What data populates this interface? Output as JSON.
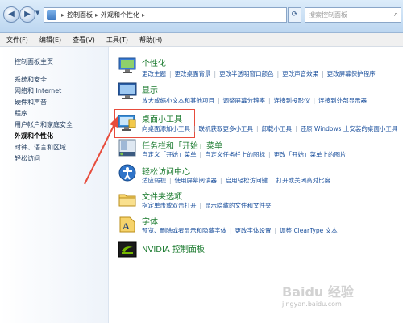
{
  "address": {
    "crumbs": [
      "控制面板",
      "外观和个性化"
    ],
    "search_placeholder": "搜索控制面板"
  },
  "menubar": {
    "items": [
      "文件(F)",
      "编辑(E)",
      "查看(V)",
      "工具(T)",
      "帮助(H)"
    ]
  },
  "sidebar": {
    "home": "控制面板主页",
    "items": [
      "系统和安全",
      "网络和 Internet",
      "硬件和声音",
      "程序",
      "用户帐户和家庭安全",
      "外观和个性化",
      "时钟、语言和区域",
      "轻松访问"
    ],
    "active_index": 5
  },
  "categories": [
    {
      "title": "个性化",
      "icon": "personalization-icon",
      "links": [
        "更改主题",
        "更改桌面背景",
        "更改半透明窗口颜色",
        "更改声音效果",
        "更改屏幕保护程序"
      ]
    },
    {
      "title": "显示",
      "icon": "display-icon",
      "links": [
        "放大或缩小文本和其他项目",
        "调整屏幕分辨率",
        "连接到投影仪",
        "连接到外部显示器"
      ]
    },
    {
      "title": "桌面小工具",
      "icon": "gadgets-icon",
      "links": [
        "向桌面添加小工具",
        "联机获取更多小工具",
        "卸载小工具",
        "还原 Windows 上安装的桌面小工具"
      ]
    },
    {
      "title": "任务栏和「开始」菜单",
      "icon": "taskbar-icon",
      "links": [
        "自定义「开始」菜单",
        "自定义任务栏上的图标",
        "更改「开始」菜单上的图片"
      ]
    },
    {
      "title": "轻松访问中心",
      "icon": "ease-of-access-icon",
      "links": [
        "适应弱视",
        "使用屏幕阅读器",
        "启用轻松访问键",
        "打开或关闭高对比度"
      ]
    },
    {
      "title": "文件夹选项",
      "icon": "folder-options-icon",
      "links": [
        "指定单击或双击打开",
        "显示隐藏的文件和文件夹"
      ]
    },
    {
      "title": "字体",
      "icon": "fonts-icon",
      "links": [
        "预览、删除或者显示和隐藏字体",
        "更改字体设置",
        "调整 ClearType 文本"
      ]
    },
    {
      "title": "NVIDIA 控制面板",
      "icon": "nvidia-icon",
      "links": []
    }
  ],
  "watermark": {
    "big": "Baidu 经验",
    "small": "jingyan.baidu.com"
  },
  "colors": {
    "highlight": "#e74c3c",
    "title_green": "#1a7a2e",
    "link_blue": "#1a4f9c"
  }
}
